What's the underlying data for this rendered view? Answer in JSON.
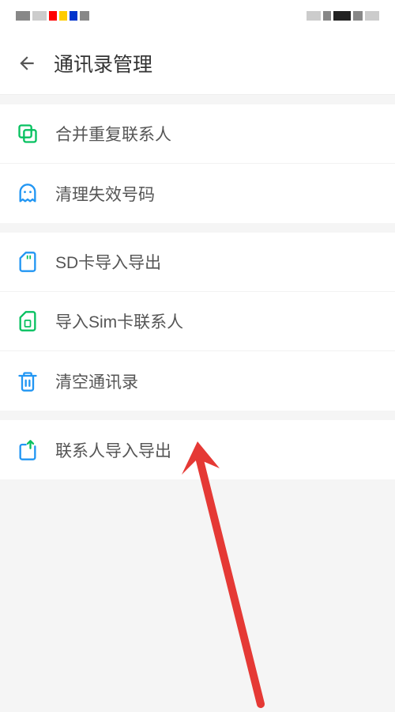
{
  "header": {
    "title": "通讯录管理"
  },
  "sections": [
    {
      "items": [
        {
          "icon": "merge-duplicate",
          "label": "合并重复联系人"
        },
        {
          "icon": "ghost",
          "label": "清理失效号码"
        }
      ]
    },
    {
      "items": [
        {
          "icon": "sd-card",
          "label": "SD卡导入导出"
        },
        {
          "icon": "sim-card",
          "label": "导入Sim卡联系人"
        },
        {
          "icon": "trash",
          "label": "清空通讯录"
        }
      ]
    },
    {
      "items": [
        {
          "icon": "import-export",
          "label": "联系人导入导出"
        }
      ]
    }
  ],
  "colors": {
    "green": "#07c160",
    "blue": "#2196f3",
    "red_arrow": "#e53935"
  }
}
